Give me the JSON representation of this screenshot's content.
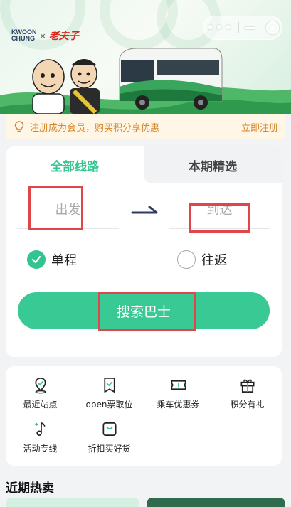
{
  "banner": {
    "logo_text_line1": "KWOON",
    "logo_text_line2": "CHUNG",
    "logo_separator": "×",
    "partner_brand": "老夫子",
    "capsule_icons": [
      "more-dots-icon",
      "minimize-icon",
      "close-circle-icon"
    ]
  },
  "notice": {
    "icon": "lightbulb-icon",
    "text": "注册成为会员，购买积分享优惠",
    "link": "立即注册",
    "color": "#d4862b"
  },
  "search": {
    "tabs": [
      {
        "label": "全部线路",
        "active": true
      },
      {
        "label": "本期精选",
        "active": false
      }
    ],
    "from_placeholder": "出发",
    "to_placeholder": "到达",
    "trip_types": [
      {
        "label": "单程",
        "checked": true
      },
      {
        "label": "往返",
        "checked": false
      }
    ],
    "button_label": "搜索巴士",
    "accent_color": "#38c994"
  },
  "services": [
    {
      "label": "最近站点",
      "icon": "location-pin-icon"
    },
    {
      "label": "open票取位",
      "icon": "ticket-check-icon"
    },
    {
      "label": "乘车优惠券",
      "icon": "coupon-icon"
    },
    {
      "label": "积分有礼",
      "icon": "gift-icon"
    },
    {
      "label": "活动专线",
      "icon": "music-note-icon"
    },
    {
      "label": "折扣买好货",
      "icon": "shopping-bag-icon"
    }
  ],
  "hot_section": {
    "title": "近期热卖"
  }
}
